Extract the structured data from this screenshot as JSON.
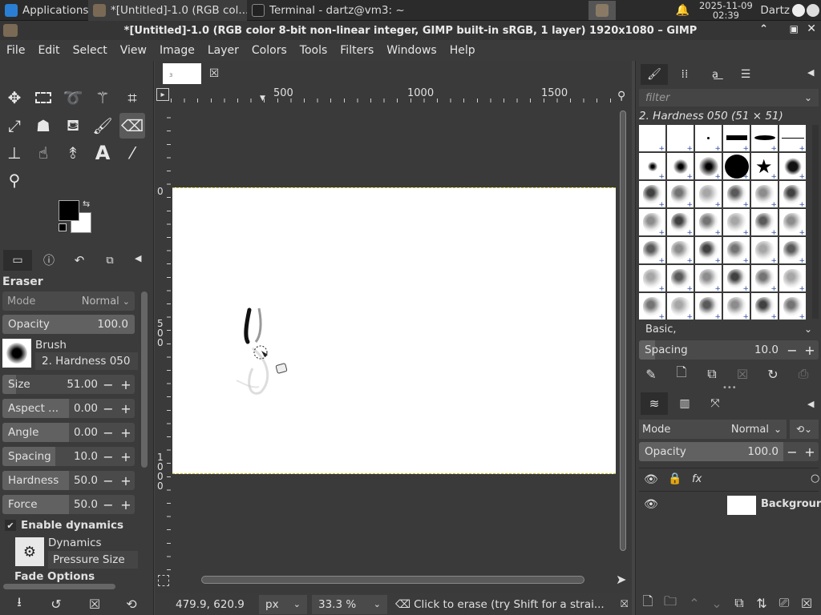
{
  "taskbar": {
    "applications": "Applications",
    "windows": [
      {
        "title": "*[Untitled]-1.0 (RGB col..."
      },
      {
        "title": "Terminal - dartz@vm3: ~"
      }
    ],
    "date": "2025-11-09",
    "time": "02:39",
    "user": "Dartz"
  },
  "window": {
    "title": "*[Untitled]-1.0 (RGB color 8-bit non-linear integer, GIMP built-in sRGB, 1 layer) 1920x1080 – GIMP"
  },
  "menu": [
    "File",
    "Edit",
    "Select",
    "View",
    "Image",
    "Layer",
    "Colors",
    "Tools",
    "Filters",
    "Windows",
    "Help"
  ],
  "tool_options": {
    "title": "Eraser",
    "mode_label": "Mode",
    "mode_value": "Normal",
    "opacity": {
      "label": "Opacity",
      "value": "100.0",
      "fraction": 1.0
    },
    "brush_label": "Brush",
    "brush_value": "2. Hardness 050",
    "size": {
      "label": "Size",
      "value": "51.00",
      "fraction": 0.1
    },
    "aspect": {
      "label": "Aspect ...",
      "value": "0.00",
      "fraction": 0.5
    },
    "angle": {
      "label": "Angle",
      "value": "0.00",
      "fraction": 0.5
    },
    "spacing": {
      "label": "Spacing",
      "value": "10.0",
      "fraction": 0.4
    },
    "hardness": {
      "label": "Hardness",
      "value": "50.0",
      "fraction": 0.5
    },
    "force": {
      "label": "Force",
      "value": "50.0",
      "fraction": 0.5
    },
    "enable_dynamics": "Enable dynamics",
    "dynamics_label": "Dynamics",
    "dynamics_value": "Pressure Size",
    "fade_options": "Fade Options"
  },
  "rulers": {
    "h": [
      "500",
      "1000",
      "1500"
    ],
    "v": [
      "0",
      "500",
      "1000"
    ]
  },
  "status": {
    "coords": "479.9, 620.9",
    "unit": "px",
    "zoom": "33.3 %",
    "message": "Click to erase (try Shift for a strai..."
  },
  "brushes": {
    "filter_placeholder": "filter",
    "selected": "2. Hardness 050 (51 × 51)",
    "tag": "Basic,",
    "spacing": {
      "label": "Spacing",
      "value": "10.0",
      "fraction": 0.1
    }
  },
  "layers": {
    "mode_label": "Mode",
    "mode_value": "Normal",
    "opacity": {
      "label": "Opacity",
      "value": "100.0",
      "fraction": 1.0
    },
    "layer_name": "Backgrour"
  },
  "colors": {
    "accent": "#5a5a5a",
    "canvas": "#ffffff",
    "fg": "#000000",
    "bg": "#ffffff"
  }
}
